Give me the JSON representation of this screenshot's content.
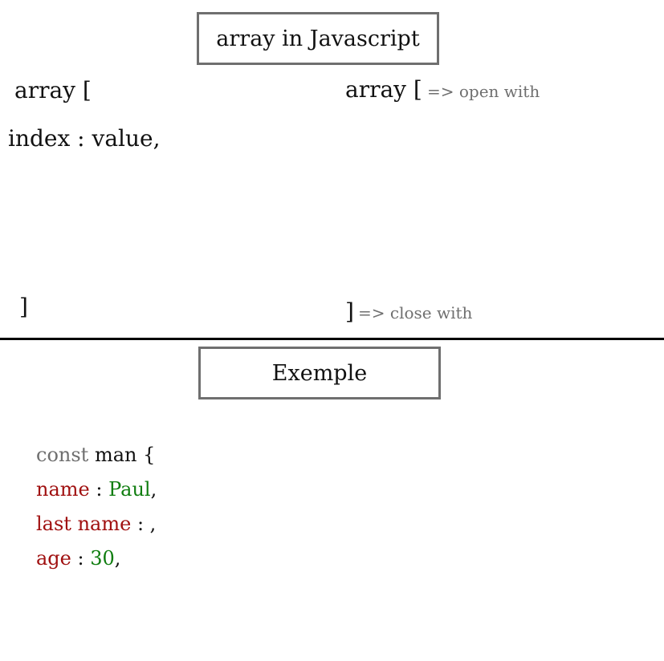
{
  "title": "array in Javascript",
  "left_column": {
    "open": "array [",
    "entry": "index : value,",
    "close": "]"
  },
  "right_column": {
    "open": "array [",
    "open_note": "=> open with",
    "close": "]",
    "close_note": "=> close with"
  },
  "example": {
    "title": "Exemple",
    "line1": {
      "keyword": "const",
      "name": "man {"
    },
    "line2": {
      "key": "name",
      "sep": " : ",
      "value": "Paul",
      "end": ","
    },
    "line3": {
      "key": "last name",
      "sep": " : ",
      "value": "",
      "end": ","
    },
    "line4": {
      "key": "age",
      "sep": " : ",
      "value": "30",
      "end": ","
    }
  },
  "colors": {
    "key": "#a01010",
    "value": "#0f7d0f",
    "keyword": "#6f6f6f",
    "box_border": "#6f6f6f"
  }
}
